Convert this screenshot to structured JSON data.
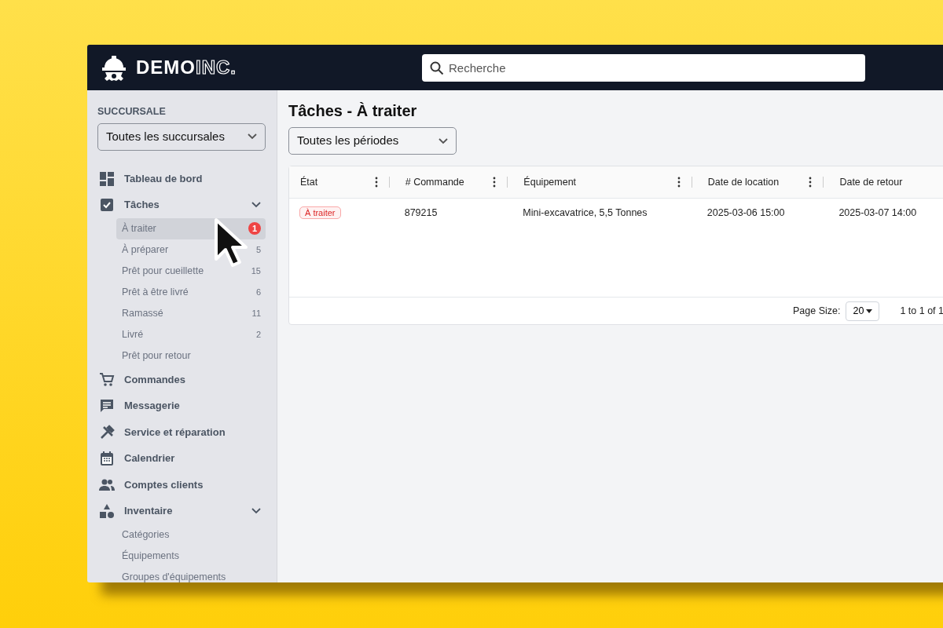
{
  "brand": {
    "name": "DEMO",
    "suffix": "INC."
  },
  "search": {
    "placeholder": "Recherche"
  },
  "sidebar": {
    "branch_label": "SUCCURSALE",
    "branch_select": "Toutes les succursales",
    "items": [
      {
        "label": "Tableau de bord"
      },
      {
        "label": "Tâches",
        "expanded": true,
        "children": [
          {
            "label": "À traiter",
            "count": "1",
            "alert": true,
            "selected": true
          },
          {
            "label": "À préparer",
            "count": "5",
            "alert": false,
            "selected": false
          },
          {
            "label": "Prêt pour cueillette",
            "count": "15",
            "alert": false,
            "selected": false
          },
          {
            "label": "Prêt à être livré",
            "count": "6",
            "alert": false,
            "selected": false
          },
          {
            "label": "Ramassé",
            "count": "11",
            "alert": false,
            "selected": false
          },
          {
            "label": "Livré",
            "count": "2",
            "alert": false,
            "selected": false
          },
          {
            "label": "Prêt pour retour",
            "selected": false
          }
        ]
      },
      {
        "label": "Commandes"
      },
      {
        "label": "Messagerie"
      },
      {
        "label": "Service et réparation"
      },
      {
        "label": "Calendrier"
      },
      {
        "label": "Comptes clients"
      },
      {
        "label": "Inventaire",
        "expanded": true,
        "children": [
          {
            "label": "Catégories",
            "selected": false
          },
          {
            "label": "Équipements",
            "selected": false
          },
          {
            "label": "Groupes d'équipements",
            "selected": false
          }
        ]
      }
    ]
  },
  "page": {
    "title": "Tâches - À traiter",
    "period_select": "Toutes les périodes"
  },
  "table": {
    "columns": [
      {
        "label": "État"
      },
      {
        "label": "# Commande"
      },
      {
        "label": "Équipement"
      },
      {
        "label": "Date de location"
      },
      {
        "label": "Date de retour"
      }
    ],
    "rows": [
      {
        "cells": [
          {
            "kind": "status",
            "text": "À traiter"
          },
          {
            "kind": "text",
            "text": "879215"
          },
          {
            "kind": "text",
            "text": "Mini-excavatrice, 5,5 Tonnes"
          },
          {
            "kind": "text",
            "text": "2025-03-06 15:00"
          },
          {
            "kind": "text",
            "text": "2025-03-07 14:00"
          }
        ]
      }
    ]
  },
  "pagination": {
    "page_size_label": "Page Size:",
    "page_size": "20",
    "range": "1 to 1 of 1"
  }
}
